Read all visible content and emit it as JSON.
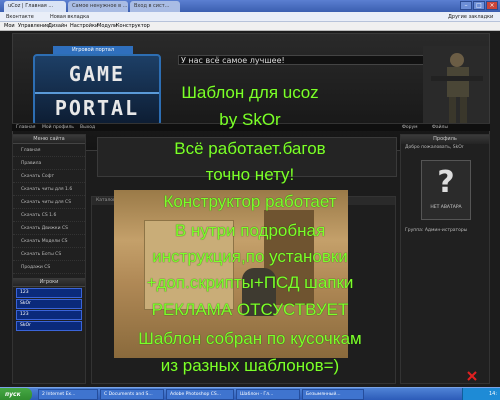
{
  "browser": {
    "tabs": [
      {
        "label": "uCoz | Главная ..."
      },
      {
        "label": "Самое ненужное в ..."
      },
      {
        "label": "Вход в сист..."
      }
    ],
    "bookmarks": [
      {
        "label": "Вконтакте"
      },
      {
        "label": "Новая вкладка"
      },
      {
        "label": "Другие закладки"
      }
    ],
    "menu": [
      {
        "label": "Мои"
      },
      {
        "label": "Управление"
      },
      {
        "label": "Дизайн"
      },
      {
        "label": "Настройки"
      },
      {
        "label": "Модули"
      },
      {
        "label": "Конструктор"
      }
    ]
  },
  "header": {
    "logo_top": "Игровой портал",
    "logo_line1": "GAME",
    "logo_line2": "PORTAL",
    "slogan": "У нас всё самое лучшее!",
    "nav": [
      "Главная",
      "Мой профиль",
      "Выход",
      "Форум",
      "Файлы"
    ]
  },
  "left": {
    "menu_title": "Меню сайта",
    "items": [
      "Главная",
      "Правила",
      "Скачать Софт",
      "Скачать читы для 1.6",
      "Скачать читы для CS",
      "Скачать CS 1.6",
      "Скачать Движки CS",
      "Скачать Модели CS",
      "Скачать Боты CS",
      "Продажи CS"
    ],
    "players_title": "Игроки",
    "players": [
      "123",
      "SkOr",
      "123",
      "SkOr"
    ]
  },
  "center": {
    "content_head": "Каталог"
  },
  "right": {
    "title": "Профиль",
    "greeting": "Добро пожаловать, SkOr",
    "avatar_caption": "НЕТ АВАТАРА",
    "group": "Группа: Админ-истраторы"
  },
  "overlay": {
    "lines": [
      "Шаблон для ucoz",
      "by SkOr",
      "Всё работает.багов",
      "точно нету!",
      "Конструктор работает",
      "В нутри подробная",
      "инструкция,по установки",
      "+доп.скрипты+ПСД шапки",
      "РЕКЛАМА ОТСУСТВУЕТ",
      "Шаблон собран по кусочкам",
      "из разных шаблонов=)"
    ],
    "color": "#7cff2a"
  },
  "taskbar": {
    "start": "пуск",
    "tasks": [
      {
        "label": "2 Internet Ex..."
      },
      {
        "label": "С Documents and S..."
      },
      {
        "label": "Adobe Photoshop CS..."
      },
      {
        "label": "Шаблон - Гл..."
      },
      {
        "label": "Безымянный..."
      }
    ],
    "clock": "14:"
  }
}
